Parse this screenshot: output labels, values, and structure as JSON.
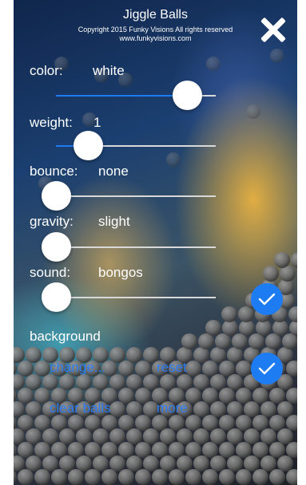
{
  "header": {
    "title": "Jiggle Balls",
    "copyright": "Copyright 2015 Funky Visions All rights reserved",
    "website": "www.funkyvisions.com"
  },
  "settings": [
    {
      "label": "color:",
      "value": "white",
      "level": 0.82
    },
    {
      "label": "weight:",
      "value": "1",
      "level": 0.2
    },
    {
      "label": "bounce:",
      "value": "none",
      "level": 0.0
    },
    {
      "label": "gravity:",
      "value": "slight",
      "level": 0.0
    },
    {
      "label": "sound:",
      "value": "bongos",
      "level": 0.0,
      "checked": true
    }
  ],
  "background": {
    "label": "background",
    "change_label": "change...",
    "reset_label": "reset",
    "checked": true
  },
  "actions": {
    "clear_label": "clear balls",
    "more_label": "more"
  },
  "colors": {
    "accent": "#1e7cf2",
    "link": "#2d7cf2",
    "ball": "#6e6e6e"
  },
  "icons": {
    "close": "close-icon",
    "check": "checkmark-icon"
  }
}
